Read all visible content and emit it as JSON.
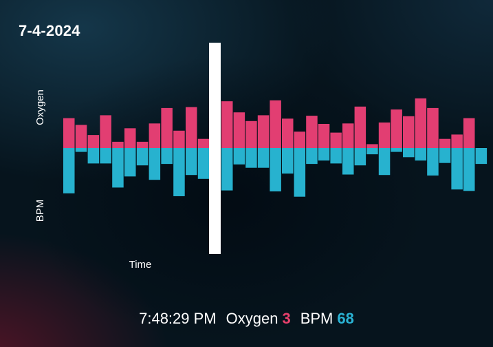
{
  "header": {
    "date": "7-4-2024"
  },
  "status": {
    "time": "7:48:29 PM",
    "oxygen_label": "Oxygen",
    "oxygen_value": "3",
    "bpm_label": "BPM",
    "bpm_value": "68"
  },
  "colors": {
    "oxygen": "#e23e72",
    "bpm": "#27b2cf",
    "cursor": "#ffffff"
  },
  "chart_data": {
    "type": "bar",
    "xlabel": "Time",
    "ylabel_top": "Oxygen",
    "ylabel_bottom": "BPM",
    "cursor_after_index": 11,
    "series": [
      {
        "name": "Oxygen",
        "values": [
          6.2,
          4.8,
          2.7,
          6.8,
          1.3,
          4.1,
          1.3,
          5.1,
          8.3,
          3.6,
          8.5,
          1.9,
          9.7,
          7.4,
          5.6,
          6.8,
          9.9,
          6.1,
          3.4,
          6.7,
          5.0,
          3.2,
          5.1,
          8.6,
          0.8,
          5.3,
          8.0,
          6.6,
          10.3,
          8.3,
          1.9,
          2.8,
          6.2
        ]
      },
      {
        "name": "BPM",
        "values": [
          9.4,
          0.8,
          3.2,
          3.2,
          8.2,
          5.9,
          3.6,
          6.6,
          3.3,
          10.0,
          5.6,
          6.4,
          8.8,
          3.4,
          4.1,
          4.1,
          9.0,
          5.3,
          10.1,
          3.3,
          2.6,
          3.2,
          5.5,
          3.6,
          1.3,
          5.6,
          0.8,
          1.9,
          2.6,
          5.7,
          3.1,
          8.6,
          8.9,
          3.3
        ]
      }
    ]
  }
}
